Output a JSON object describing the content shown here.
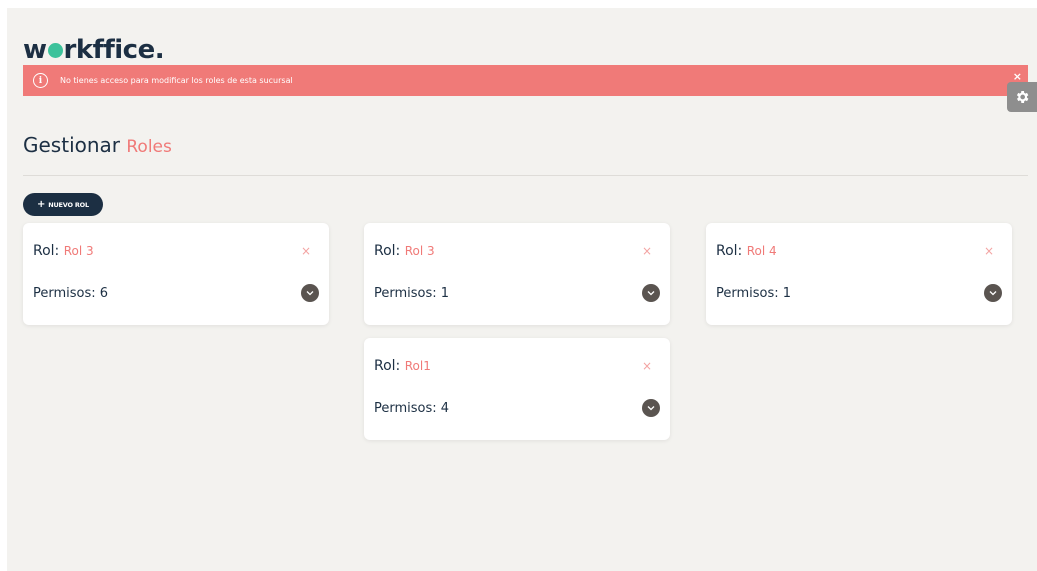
{
  "brand": {
    "pre": "w",
    "post": "rkffice."
  },
  "alert": {
    "message": "No tienes acceso para modificar los roles de esta sucursal",
    "close": "×"
  },
  "page": {
    "title": "Gestionar",
    "title_accent": "Roles"
  },
  "toolbar": {
    "new_role_label": "NUEVO ROL",
    "plus": "+"
  },
  "role_label": "Rol:",
  "perm_label": "Permisos:",
  "cards": [
    {
      "name": "Rol 3",
      "perms": "6"
    },
    {
      "name": "Rol 3",
      "perms": "1"
    },
    {
      "name": "Rol 4",
      "perms": "1"
    },
    {
      "name": "Rol1",
      "perms": "4"
    }
  ],
  "close_glyph": "×",
  "colors": {
    "brand_dark": "#1c2f43",
    "accent": "#f07a78",
    "brand_green": "#3cc29b"
  }
}
